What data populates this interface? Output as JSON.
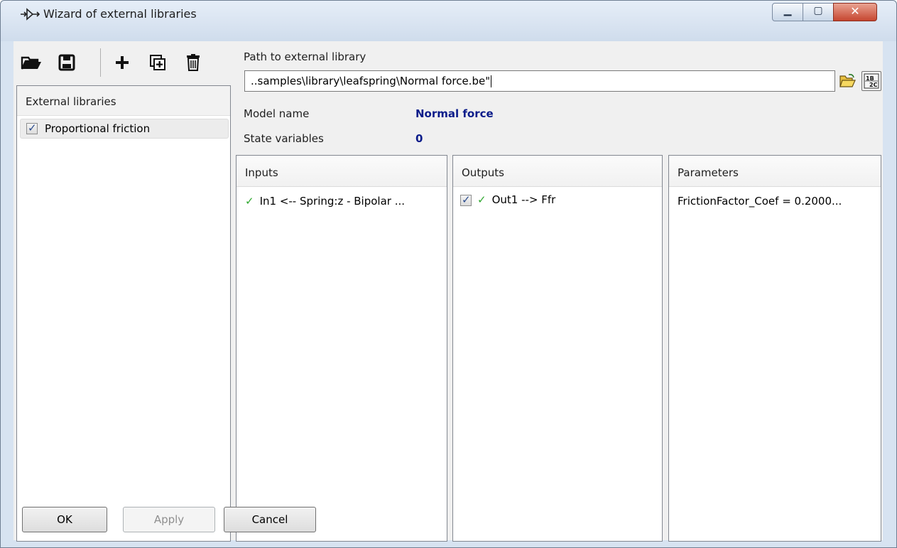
{
  "window": {
    "title": "Wizard of external libraries",
    "title_icon": "arrow-wizard-icon",
    "controls": {
      "minimize": "minimize-icon",
      "maximize": "maximize-icon",
      "close": "close-icon"
    }
  },
  "toolbar": {
    "buttons": [
      "open-folder-icon",
      "save-icon",
      "add-icon",
      "add-copy-icon",
      "delete-icon"
    ]
  },
  "libraries": {
    "header": "External libraries",
    "items": [
      {
        "label": "Proportional friction",
        "checked": true
      }
    ]
  },
  "path": {
    "label": "Path to external library",
    "value": "..samples\\library\\leafspring\\Normal force.be\""
  },
  "info": {
    "model_name_label": "Model name",
    "model_name_value": "Normal force",
    "state_vars_label": "State variables",
    "state_vars_value": "0"
  },
  "inputs": {
    "header": "Inputs",
    "items": [
      {
        "status": "✓",
        "text": "In1 <-- Spring:z - Bipolar ..."
      }
    ]
  },
  "outputs": {
    "header": "Outputs",
    "items": [
      {
        "checked": true,
        "status": "✓",
        "text": "Out1 --> Ffr"
      }
    ]
  },
  "parameters": {
    "header": "Parameters",
    "items": [
      {
        "text": "FrictionFactor_Coef = 0.2000..."
      }
    ]
  },
  "footer": {
    "ok_label": "OK",
    "apply_label": "Apply",
    "cancel_label": "Cancel"
  },
  "colors": {
    "model_value": "#0b1c8a",
    "ok_check": "#2fa82f",
    "close_button": "#c64630"
  }
}
